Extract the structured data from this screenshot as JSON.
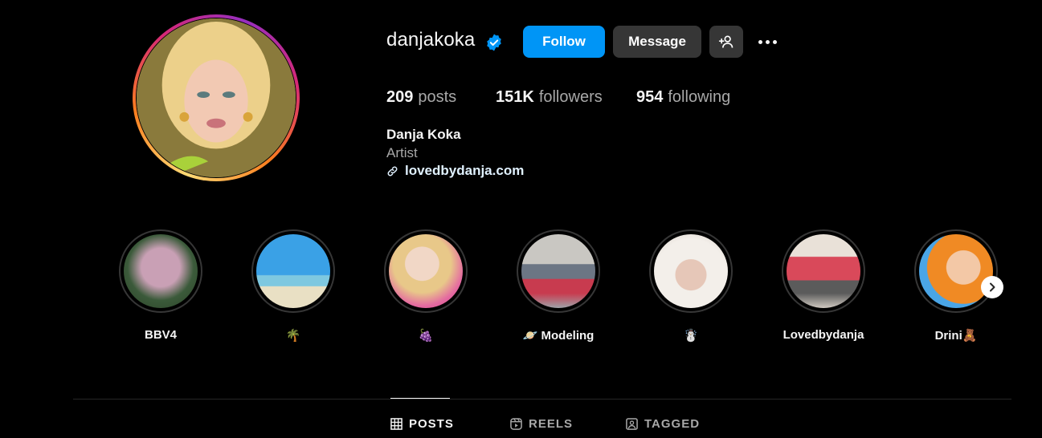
{
  "profile": {
    "username": "danjakoka",
    "verified": true,
    "full_name": "Danja Koka",
    "category": "Artist",
    "link": "lovedbydanja.com"
  },
  "actions": {
    "follow_label": "Follow",
    "message_label": "Message",
    "add_user_icon": "person-add-icon",
    "more_icon": "ellipsis-icon"
  },
  "stats": {
    "posts_count": "209",
    "posts_label": "posts",
    "followers_count": "151K",
    "followers_label": "followers",
    "following_count": "954",
    "following_label": "following"
  },
  "highlights": [
    {
      "label": "BBV4"
    },
    {
      "label": "🌴"
    },
    {
      "label": "🍇"
    },
    {
      "label": "🪐 Modeling"
    },
    {
      "label": "☃️"
    },
    {
      "label": "Lovedbydanja"
    },
    {
      "label": "Drini🧸"
    }
  ],
  "tabs": [
    {
      "label": "POSTS",
      "icon": "grid-icon",
      "active": true
    },
    {
      "label": "REELS",
      "icon": "reels-icon",
      "active": false
    },
    {
      "label": "TAGGED",
      "icon": "tagged-icon",
      "active": false
    }
  ],
  "colors": {
    "background": "#000000",
    "follow_button": "#0095f6",
    "secondary_button": "#363636",
    "verified_badge": "#0095f6",
    "muted_text": "#a8a8a8"
  }
}
